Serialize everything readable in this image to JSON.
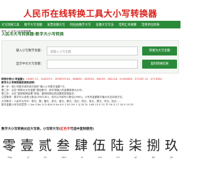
{
  "header": {
    "title": "人民币在线转换工具大小写转换器"
  },
  "nav": {
    "items": [
      "大写转换工具",
      "数字大写金额",
      "发票金额大写",
      "阿拉伯数字大写",
      "金额大写写法",
      "常用汇率换算",
      "常用单位转换"
    ]
  },
  "breadcrumb": {
    "home": "首页",
    "path": "> 大写人民币转换器"
  },
  "section": {
    "title": "人民币大写转换器-数字大小写转换"
  },
  "form": {
    "number_label": "输入小写数字金额：",
    "number_placeholder": "请输入小写金额",
    "convert_button": "转换为大写金额",
    "chinese_label": "显示中文大写金额：",
    "chinese_placeholder": "",
    "copy_button": "复制转换结果"
  },
  "info": {
    "example_label": "转换示例(小写金额)：",
    "examples": "10667.12 , 140029.2 , 3958709.04 , 368830 , 463034 , 380.69 , 364118 , 10180606 , 371287.12 , 3713084 ,",
    "howto_title": "数字大小写转换器的使用说明：",
    "steps": [
      "第一步：将小写数字填写到左侧的“输入小写数字金额”中；",
      "第二步：点击“转换为大写金额”按钮即可，即可将输入的金额转换为大写；",
      "第三步：点击“复制转换结果”按钮，复制转换后的结果到剪贴板中。",
      "注意事项：数字可以含有小数点(0980.80)，也可以不填写小数位(0980)；小写的金额数字最大可支持到万亿。",
      "大写数字：人民币大写中：零元，整；壹元，贰元，叁元，肆元，伍元，陆元，柒元，捌元，玖元，拾元……",
      "数字金额小写中的意思: 1 Xie 0 Bo 1C0 4D4 6 Xa 8 9 2 0G 5H 1 1J 2K 3L 14M 15 0 15 7P 16 Q 17 18 9 19 20"
    ]
  },
  "digits_section": {
    "title_prefix": "数字大小写转换对应大写表，小写转大写(",
    "title_red": "红色字",
    "title_suffix": "可选中复制使用)"
  },
  "uppercase_digits": [
    "零",
    "壹",
    "贰",
    "叁",
    "肆",
    "伍",
    "陆",
    "柒",
    "捌",
    "玖"
  ],
  "pinyin": [
    "líng",
    "yī",
    "èr",
    "sān",
    "sì",
    "wǔ",
    "liù",
    "qī",
    "bā",
    "jiǔ"
  ],
  "colors": {
    "brand_red": "#d9211c",
    "nav_green": "#2b8a3a"
  }
}
